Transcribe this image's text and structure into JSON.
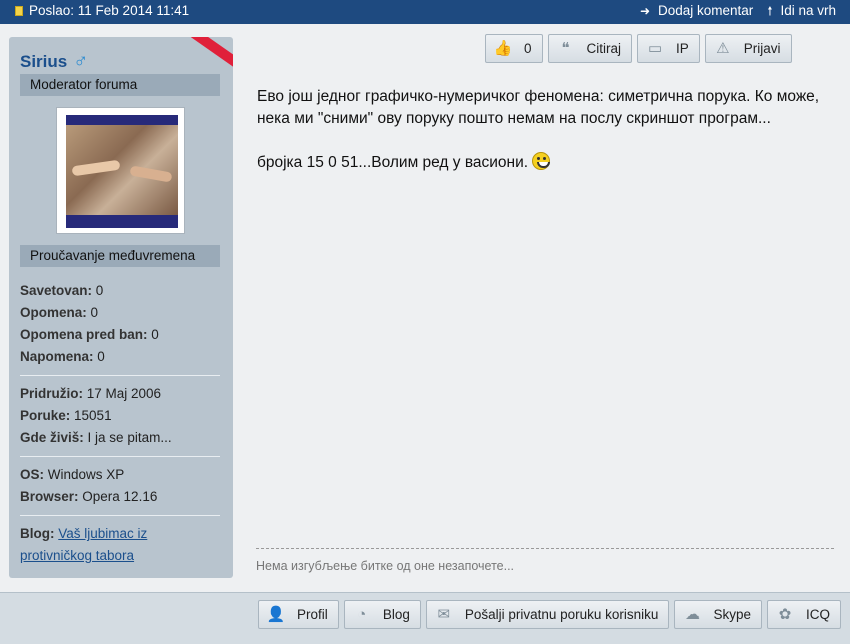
{
  "topbar": {
    "posted": "Poslao: 11 Feb 2014 11:41",
    "add_comment": "Dodaj komentar",
    "go_top": "Idi na vrh"
  },
  "user": {
    "name": "Sirius",
    "gender_symbol": "♂",
    "rank": "Moderator foruma",
    "title": "Proučavanje međuvremena",
    "stats1": [
      {
        "label": "Savetovan:",
        "value": "0"
      },
      {
        "label": "Opomena:",
        "value": "0"
      },
      {
        "label": "Opomena pred ban:",
        "value": "0"
      },
      {
        "label": "Napomena:",
        "value": "0"
      }
    ],
    "stats2": [
      {
        "label": "Pridružio:",
        "value": "17 Maj 2006"
      },
      {
        "label": "Poruke:",
        "value": "15051"
      },
      {
        "label": "Gde živiš:",
        "value": "I ja se pitam..."
      }
    ],
    "stats3": [
      {
        "label": "OS:",
        "value": "Windows XP"
      },
      {
        "label": "Browser:",
        "value": "Opera 12.16"
      }
    ],
    "blog_label": "Blog:",
    "blog_link_line1": "Vaš ljubimac iz",
    "blog_link_line2": "protivničkog tabora"
  },
  "post_actions": {
    "like_count": "0",
    "quote": "Citiraj",
    "ip": "IP",
    "report": "Prijavi"
  },
  "post": {
    "paragraph1": "Ево још једног графичко-нумеричког феномена: симетрична порука. Ко може, нека ми \"сними\" ову поруку пошто немам на послу скриншот програм...",
    "paragraph2": "бројка 15 0 51...Волим ред у васиони.",
    "signature": "Нема изгубљење битке од оне незапочете..."
  },
  "bottom_actions": {
    "profile": "Profil",
    "blog": "Blog",
    "pm": "Pošalji privatnu poruku korisniku",
    "skype": "Skype",
    "icq": "ICQ"
  },
  "colors": {
    "topbar": "#1e4a80",
    "sidebar": "#b8c4ce",
    "username": "#1b4f8c",
    "ribbon": "#e0203a"
  }
}
